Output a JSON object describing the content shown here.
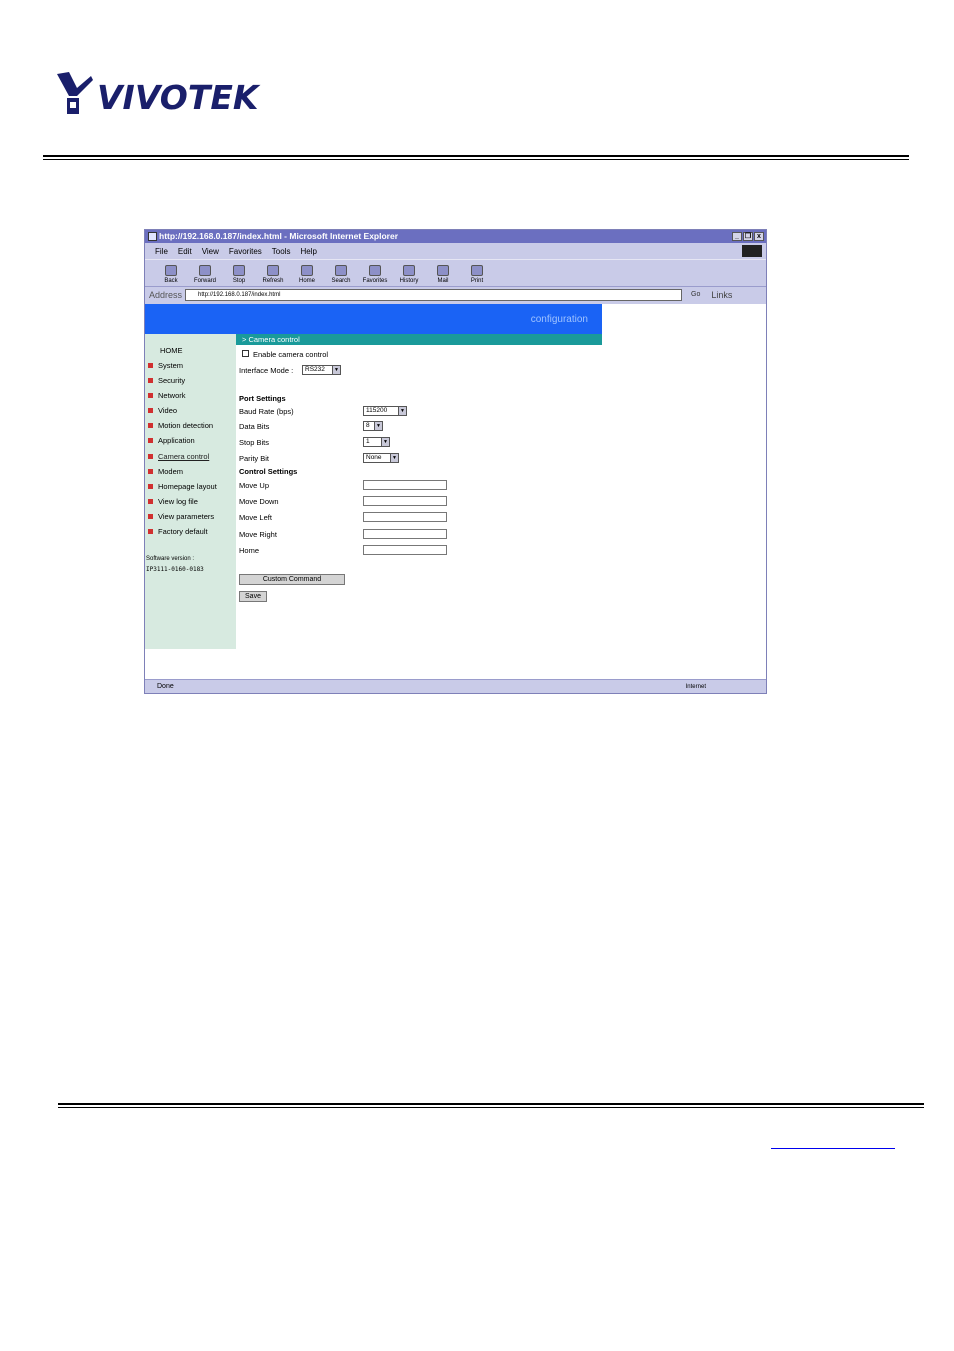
{
  "header": {
    "brand": "VIVOTEK"
  },
  "browser": {
    "title": "http://192.168.0.187/index.html - Microsoft Internet Explorer",
    "window_buttons": [
      "_",
      "❐",
      "x"
    ],
    "menu": [
      "File",
      "Edit",
      "View",
      "Favorites",
      "Tools",
      "Help"
    ],
    "toolbar": [
      "Back",
      "Forward",
      "Stop",
      "Refresh",
      "Home",
      "Search",
      "Favorites",
      "History",
      "Mail",
      "Print"
    ],
    "address_label": "Address",
    "address_url": "http://192.168.0.187/index.html",
    "go_label": "Go",
    "links_label": "Links",
    "status_left": "Done",
    "status_zone": "Internet"
  },
  "page": {
    "banner": "configuration",
    "sidebar": {
      "home": "HOME",
      "items": [
        "System",
        "Security",
        "Network",
        "Video",
        "Motion detection",
        "Application",
        "Camera control",
        "Modem",
        "Homepage layout",
        "View log file",
        "View parameters",
        "Factory default"
      ],
      "software_version_label": "Software version :",
      "software_version": "IP3111-0160-0183"
    },
    "section_title": "> Camera control",
    "enable_label": "Enable camera control",
    "interface_mode_label": "Interface Mode :",
    "interface_mode_value": "RS232",
    "port_settings_heading": "Port Settings",
    "baud_rate_label": "Baud Rate (bps)",
    "baud_rate_value": "115200",
    "data_bits_label": "Data Bits",
    "data_bits_value": "8",
    "stop_bits_label": "Stop Bits",
    "stop_bits_value": "1",
    "parity_bit_label": "Parity Bit",
    "parity_bit_value": "None",
    "control_settings_heading": "Control Settings",
    "control_fields": [
      "Move Up",
      "Move Down",
      "Move Left",
      "Move Right",
      "Home"
    ],
    "custom_command_label": "Custom Command",
    "save_label": "Save"
  }
}
